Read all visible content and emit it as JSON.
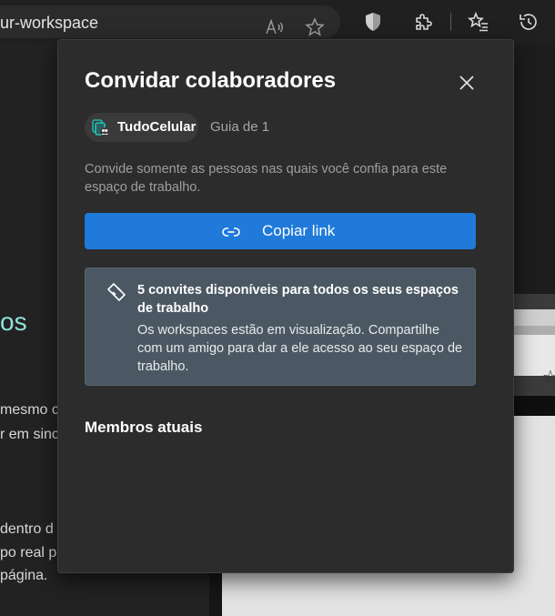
{
  "browser": {
    "url_text": "ur-workspace",
    "icons": [
      "read-aloud-icon",
      "favorite-star-icon",
      "browser-essentials-shield-icon",
      "extensions-puzzle-icon",
      "favorites-list-icon",
      "history-icon"
    ]
  },
  "background_page": {
    "heading_fragment": "os",
    "lines": [
      "mesmo c",
      "r em sinc",
      "dentro d",
      "po real p",
      "página."
    ]
  },
  "dialog": {
    "title": "Convidar colaboradores",
    "close_icon": "close-icon",
    "workspace": {
      "name": "TudoCelular",
      "icon": "workspace-collaborators-icon",
      "tab_count": "Guia de 1"
    },
    "description": "Convide somente as pessoas nas quais você confia para este espaço de trabalho.",
    "copy_link": {
      "label": "Copiar link",
      "icon": "link-icon",
      "color": "#1f7ad9"
    },
    "info": {
      "icon": "ticket-icon",
      "title": "5 convites disponíveis para todos os seus espaços de trabalho",
      "body": "Os workspaces estão em visualização. Compartilhe com um amigo para dar a ele acesso ao seu espaço de trabalho.",
      "background": "#4b5863"
    },
    "members_heading": "Membros atuais"
  },
  "colors": {
    "dialog_bg": "#2c2c2c",
    "accent_teal": "#8fe3d8"
  }
}
